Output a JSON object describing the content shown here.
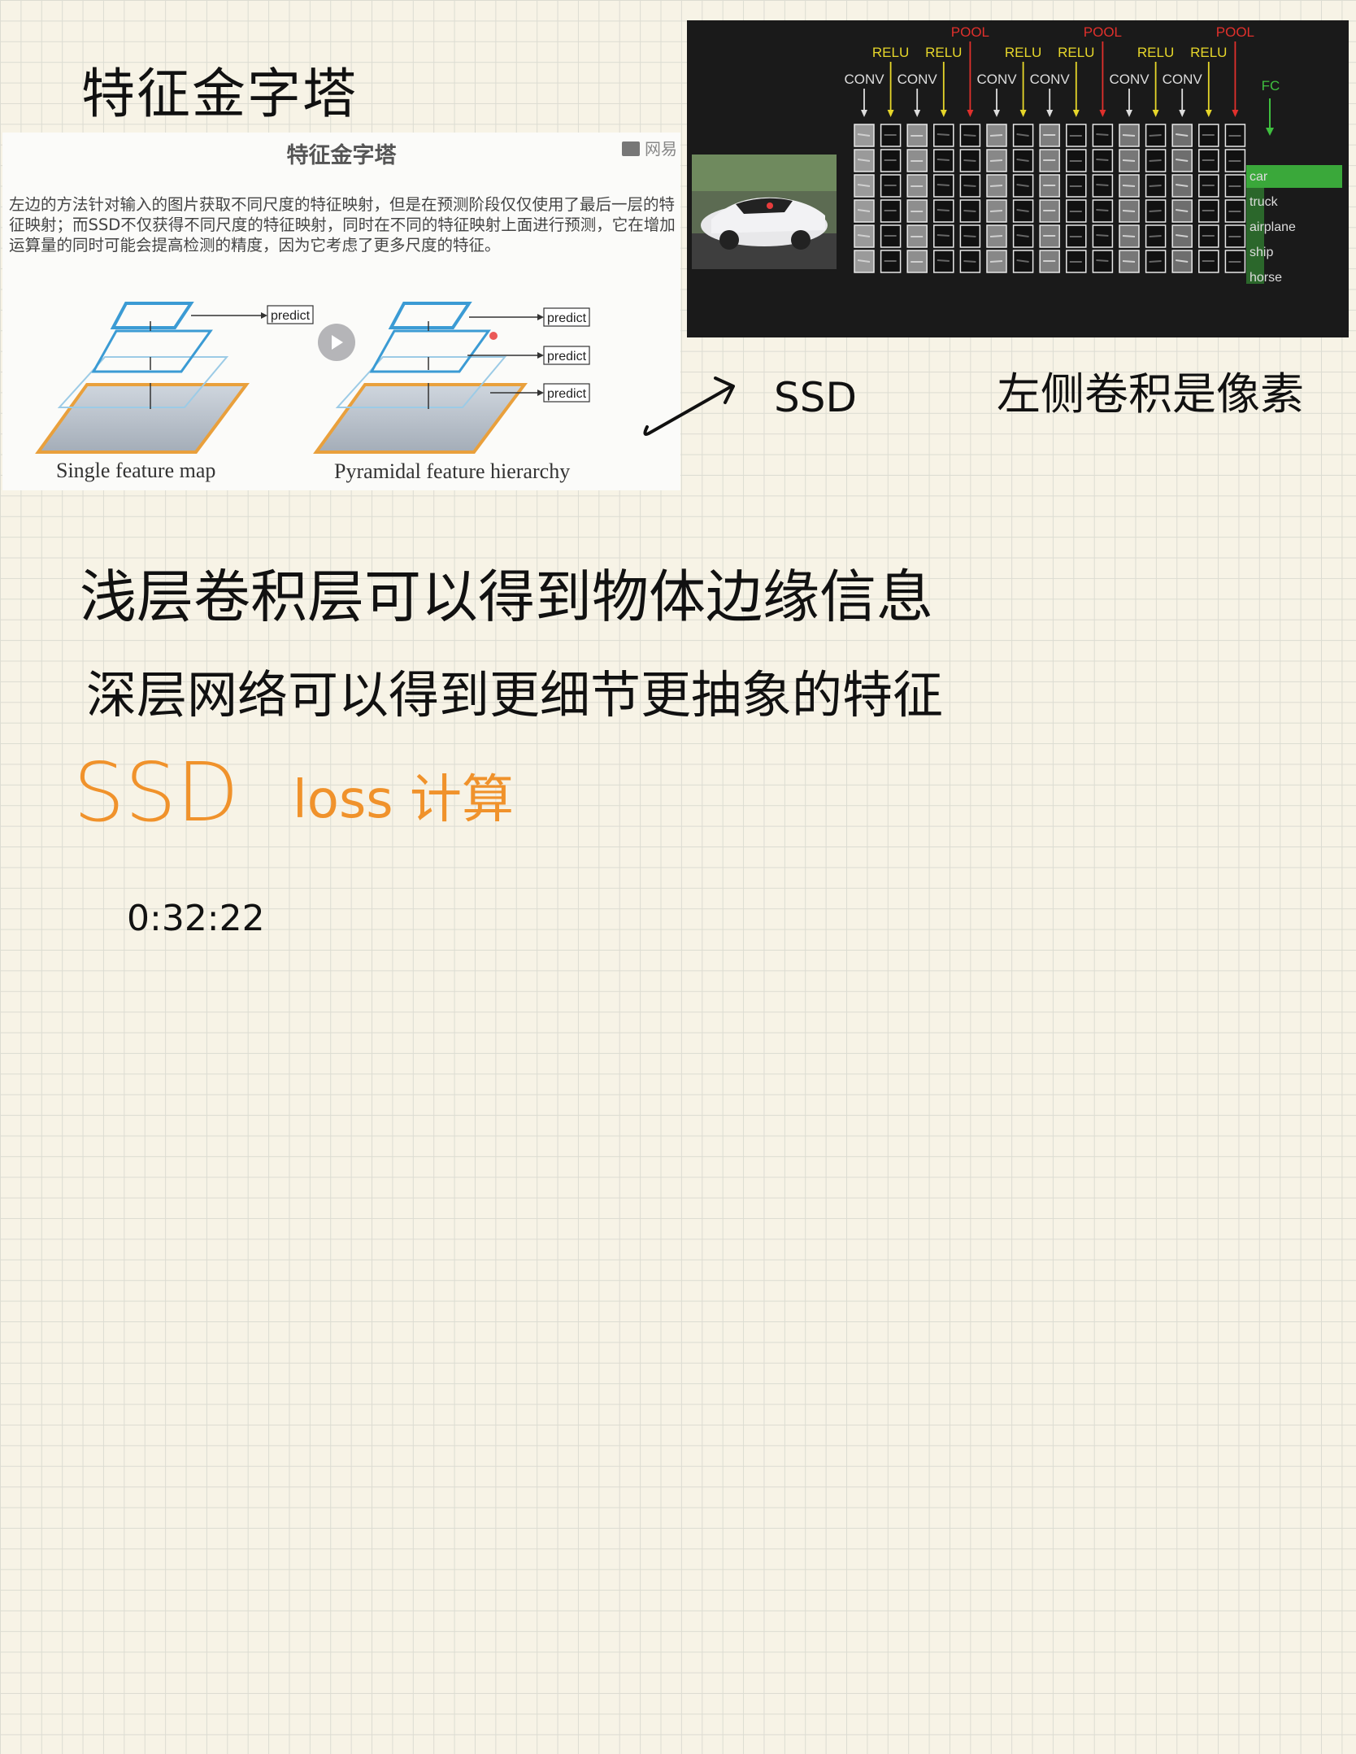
{
  "notes": {
    "title": "特征金字塔",
    "arrow_label": "SSD",
    "right_note": "左侧卷积是像素",
    "line1": "浅层卷积层可以得到物体边缘信息",
    "line2": "深层网络可以得到更细节更抽象的特征",
    "ssd_heading": "SSD",
    "loss_heading": "loss 计算",
    "timestamp": "0:32:22"
  },
  "slide_left": {
    "title": "特征金字塔",
    "brand": "网易",
    "body": "左边的方法针对输入的图片获取不同尺度的特征映射，但是在预测阶段仅仅使用了最后一层的特征映射；而SSD不仅获得不同尺度的特征映射，同时在不同的特征映射上面进行预测，它在增加运算量的同时可能会提高检测的精度，因为它考虑了更多尺度的特征。",
    "predict_label": "predict",
    "caption_left": "Single feature map",
    "caption_right": "Pyramidal feature hierarchy",
    "colors": {
      "layer_blue": "#3b9bd4",
      "base_orange": "#e9a03c"
    }
  },
  "slide_right": {
    "pool_labels": [
      "POOL",
      "POOL",
      "POOL"
    ],
    "relu_labels": [
      "RELU",
      "RELU",
      "RELU",
      "RELU",
      "RELU",
      "RELU"
    ],
    "conv_labels": [
      "CONV",
      "CONV",
      "CONV",
      "CONV",
      "CONV",
      "CONV"
    ],
    "fc_label": "FC",
    "classes": [
      "car",
      "truck",
      "airplane",
      "ship",
      "horse"
    ],
    "colors": {
      "pool": "#e0302c",
      "relu": "#e6d62a",
      "fc": "#3fbf3f",
      "car_bar": "#3aa83a"
    }
  }
}
